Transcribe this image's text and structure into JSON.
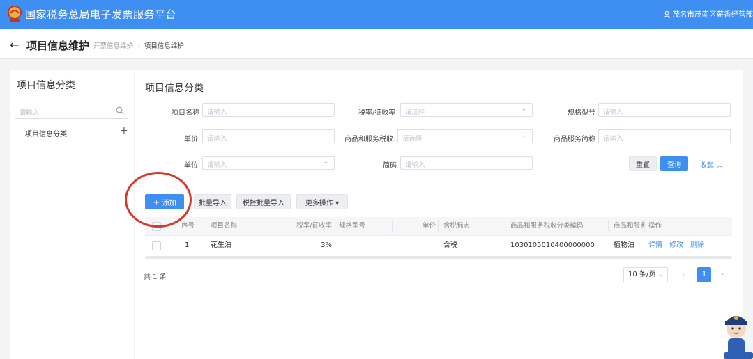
{
  "header": {
    "app_title": "国家税务总局电子发票服务平台",
    "user": "茂名市茂南区薪香经营部"
  },
  "breadcrumb": {
    "page_title": "项目信息维护",
    "items": [
      "开票信息维护",
      "项目信息维护"
    ]
  },
  "left_panel": {
    "title": "项目信息分类",
    "search_placeholder": "请输入",
    "tree_item": "项目信息分类"
  },
  "main": {
    "title": "项目信息分类",
    "filters": {
      "item_name": {
        "label": "项目名称",
        "placeholder": "请输入"
      },
      "tax_rate": {
        "label": "税率/征收率",
        "placeholder": "请选择"
      },
      "spec": {
        "label": "规格型号",
        "placeholder": "请输入"
      },
      "unit_price": {
        "label": "单价",
        "placeholder": "请输入"
      },
      "tax_code": {
        "label": "商品和服务税收...",
        "placeholder": "请选择"
      },
      "short_name": {
        "label": "商品服务简称",
        "placeholder": "请输入"
      },
      "unit": {
        "label": "单位",
        "placeholder": "请输入"
      },
      "short_code": {
        "label": "简码",
        "placeholder": "请输入"
      }
    },
    "buttons": {
      "reset": "重置",
      "search": "查询",
      "collapse": "收起 ︿",
      "add": "＋ 添加",
      "batch_import": "批量导入",
      "tax_batch_import": "税控批量导入",
      "more": "更多操作 ▾"
    },
    "table": {
      "headers": [
        "序号",
        "项目名称",
        "税率/征收率",
        "规格型号",
        "单价",
        "含税标志",
        "商品和服务税收分类编码",
        "商品和服务",
        "操作"
      ],
      "rows": [
        {
          "index": "1",
          "name": "花生油",
          "rate": "3%",
          "spec": "",
          "price": "",
          "tax_flag": "含税",
          "code": "1030105010400000000",
          "category": "植物油",
          "actions": [
            "详情",
            "修改",
            "删除"
          ]
        }
      ]
    },
    "pagination": {
      "total": "共 1 条",
      "page_size": "10 条/页",
      "current_page": "1"
    }
  },
  "colors": {
    "primary": "#3f8ff2",
    "highlight_circle": "#d33a2c"
  }
}
